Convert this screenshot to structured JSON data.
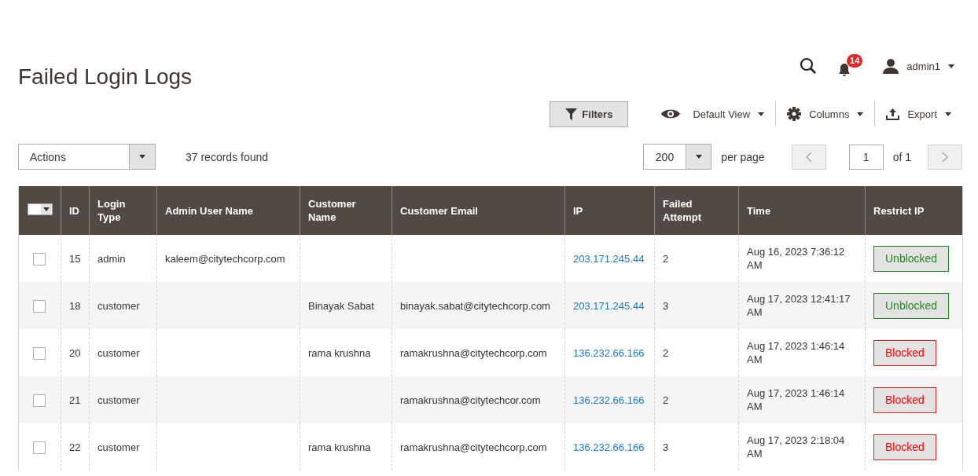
{
  "header": {
    "notifications": "14",
    "user": "admin1"
  },
  "title": "Failed Login Logs",
  "toolbar": {
    "filters": "Filters",
    "view": "Default View",
    "columns": "Columns",
    "export": "Export"
  },
  "actions": {
    "label": "Actions",
    "records": "37 records found"
  },
  "pager": {
    "per_page_value": "200",
    "per_page_label": "per page",
    "page": "1",
    "of": "of 1"
  },
  "table": {
    "select_all_checked": false,
    "columns": [
      "ID",
      "Login Type",
      "Admin User Name",
      "Customer Name",
      "Customer Email",
      "IP",
      "Failed Attempt",
      "Time",
      "Restrict IP"
    ],
    "rows": [
      {
        "checked": false,
        "id": "15",
        "login_type": "admin",
        "admin_user": "kaleem@citytechcorp.com",
        "customer_name": "",
        "customer_email": "",
        "ip": "203.171.245.44",
        "failed": "2",
        "time": "Aug 16, 2023 7:36:12 AM",
        "restrict": {
          "label": "Unblocked",
          "blocked": false
        }
      },
      {
        "checked": false,
        "id": "18",
        "login_type": "customer",
        "admin_user": "",
        "customer_name": "Binayak Sabat",
        "customer_email": "binayak.sabat@citytechcorp.com",
        "ip": "203.171.245.44",
        "failed": "3",
        "time": "Aug 17, 2023 12:41:17 AM",
        "restrict": {
          "label": "Unblocked",
          "blocked": false
        }
      },
      {
        "checked": false,
        "id": "20",
        "login_type": "customer",
        "admin_user": "",
        "customer_name": "rama krushna",
        "customer_email": "ramakrushna@citytechcorp.com",
        "ip": "136.232.66.166",
        "failed": "2",
        "time": "Aug 17, 2023 1:46:14 AM",
        "restrict": {
          "label": "Blocked",
          "blocked": true
        }
      },
      {
        "checked": false,
        "id": "21",
        "login_type": "customer",
        "admin_user": "",
        "customer_name": "",
        "customer_email": "ramakrushna@citytechcor.com",
        "ip": "136.232.66.166",
        "failed": "2",
        "time": "Aug 17, 2023 1:46:14 AM",
        "restrict": {
          "label": "Blocked",
          "blocked": true
        }
      },
      {
        "checked": false,
        "id": "22",
        "login_type": "customer",
        "admin_user": "",
        "customer_name": "rama krushna",
        "customer_email": "ramakrushna@citytechcorp.com",
        "ip": "136.232.66.166",
        "failed": "3",
        "time": "Aug 17, 2023 2:18:04 AM",
        "restrict": {
          "label": "Blocked",
          "blocked": true
        }
      }
    ]
  }
}
